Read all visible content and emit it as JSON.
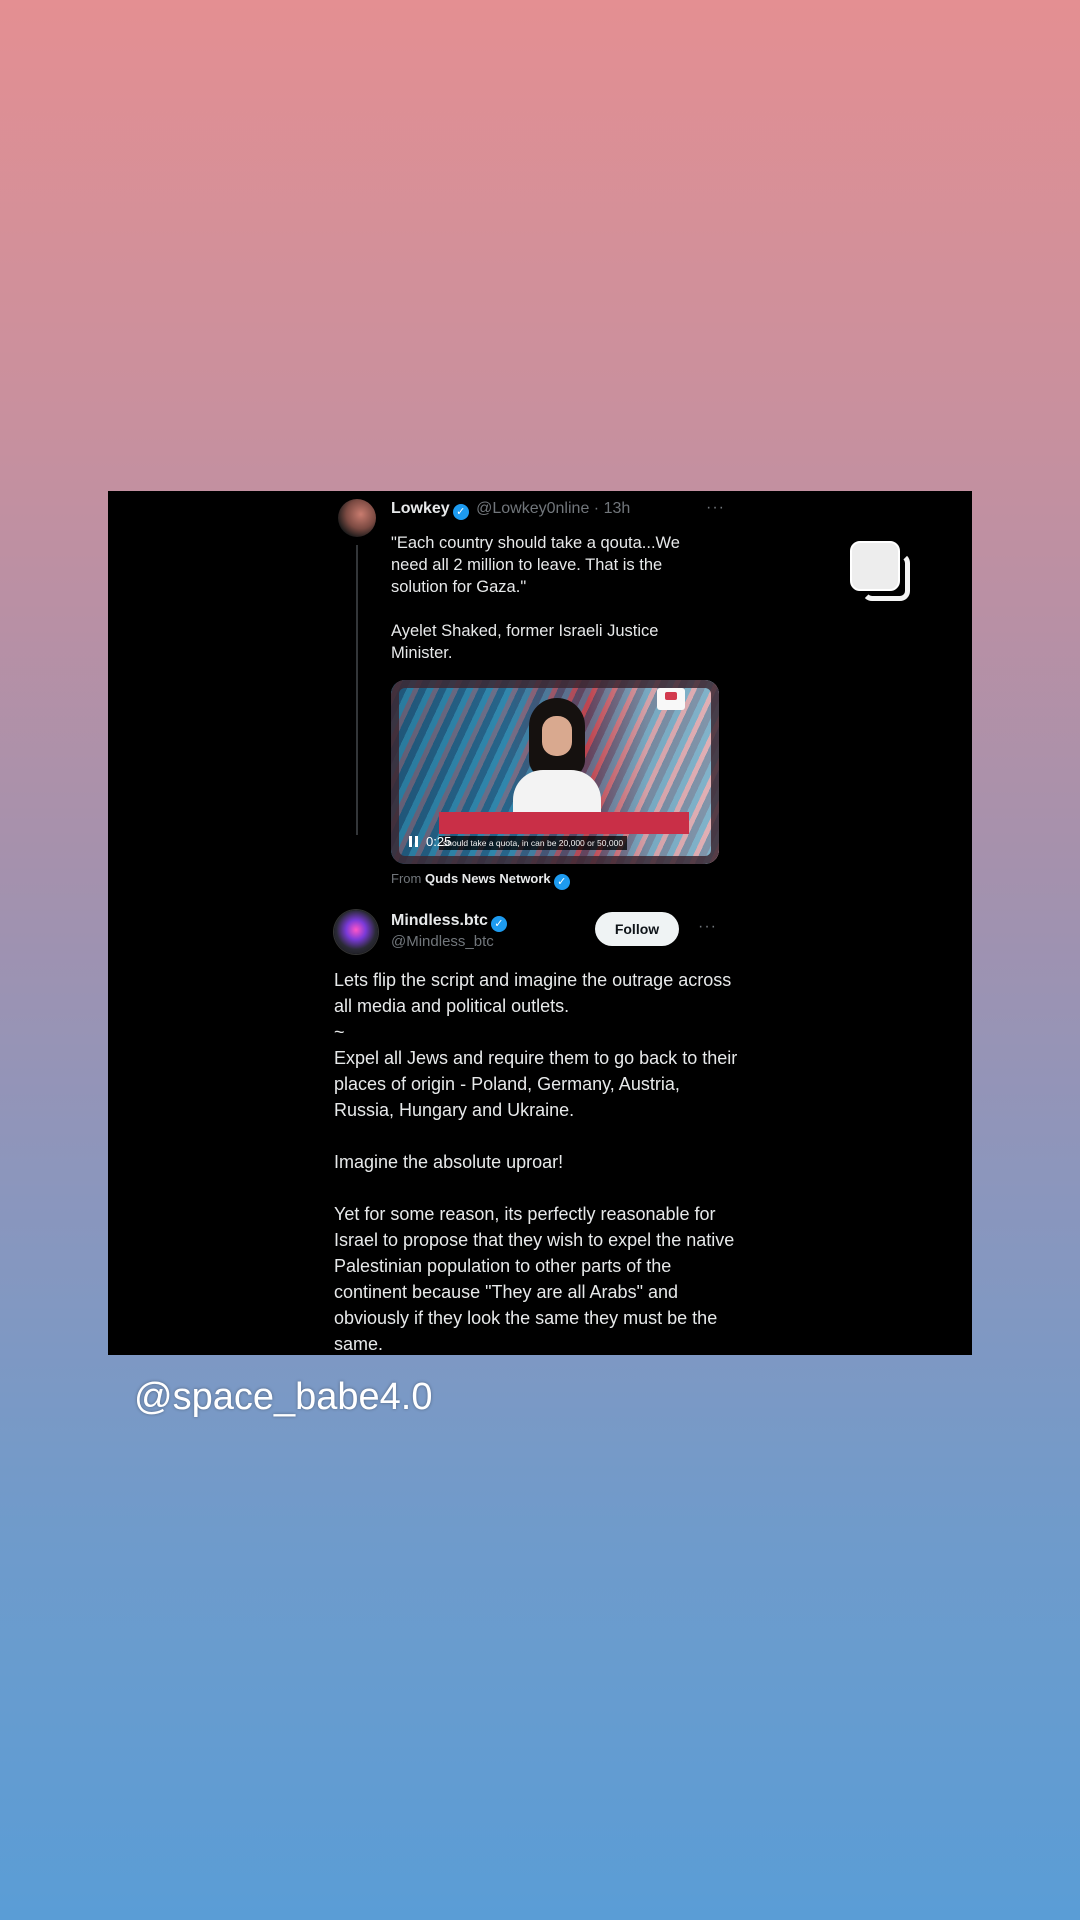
{
  "quoted_tweet": {
    "author_name": "Lowkey",
    "author_handle": "@Lowkey0nline",
    "separator": "·",
    "time": "13h",
    "more": "···",
    "text_lines": [
      "\"Each country should take a qouta...We need all 2 million to leave. That is the solution for Gaza.\"",
      "",
      "Ayelet Shaked, former Israeli Justice Minister."
    ],
    "video": {
      "timestamp": "0:25",
      "caption": "should take a quota, in can be 20,000 or 50,000"
    },
    "source_prefix": "From",
    "source_name": "Quds News Network"
  },
  "main_tweet": {
    "author_name": "Mindless.btc",
    "author_handle": "@Mindless_btc",
    "follow_label": "Follow",
    "more": "···",
    "paragraphs": [
      "Lets flip the script and imagine the outrage across all media and political outlets.",
      "~",
      "Expel all Jews and require them to go back to their places of origin - Poland, Germany, Austria, Russia, Hungary and Ukraine.",
      "",
      "Imagine the absolute uproar!",
      "",
      "Yet for some reason, its perfectly reasonable for Israel to propose that they wish to expel the native Palestinian population to other parts of the continent because \"They are all Arabs\" and obviously if they look the same they must be the same."
    ]
  },
  "story_overlay": {
    "username_tag": "@space_babe4.0",
    "multi_post_icon": "multiple-images-icon"
  },
  "colors": {
    "gradient_top": "#e48f92",
    "gradient_bottom": "#5a9dd6",
    "verified_blue": "#1d9bf0",
    "card_background": "#000000"
  }
}
